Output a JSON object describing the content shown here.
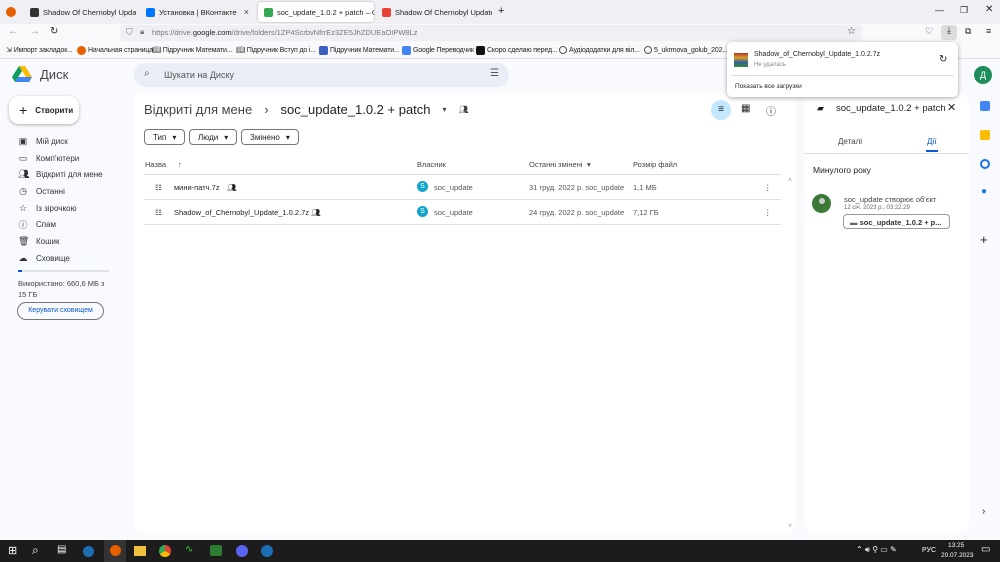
{
  "browser": {
    "tabs": [
      {
        "title": "Shadow Of Chernobyl Update 1",
        "color": "#333"
      },
      {
        "title": "Установка | ВКонтакте",
        "color": "#0077ff"
      },
      {
        "title": "soc_update_1.0.2 + patch – Goo",
        "color": "#34a853",
        "active": true
      },
      {
        "title": "Shadow Of Chernobyl Update 1",
        "color": "#ea4335"
      }
    ],
    "url_prefix": "https://drive.",
    "url_domain": "google.com",
    "url_path": "/drive/folders/1ZP4ScrbvNfrrEz3ZE5JhZDUEaOIPW8Lz",
    "bookmarks": [
      "Импорт закладок...",
      "Начальная страница",
      "Підручник Математи...",
      "Підручник Вступ до і...",
      "Підручник Математи...",
      "Google Переводчик",
      "Скоро сделаю перед...",
      "Аудіододатки для віл...",
      "5_ukrmova_golub_202..."
    ]
  },
  "download": {
    "file": "Shadow_of_Chernobyl_Update_1.0.2.7z",
    "status": "Не удалась",
    "show_all": "Показать все загрузки"
  },
  "drive": {
    "logo": "Диск",
    "search_placeholder": "Шукати на Диску",
    "create": "Створити",
    "avatar": "Д",
    "nav": [
      {
        "label": "Мій диск",
        "icon": "drive-icon"
      },
      {
        "label": "Комп'ютери",
        "icon": "computer-icon"
      },
      {
        "label": "Відкриті для мене",
        "icon": "shared-icon"
      },
      {
        "label": "Останні",
        "icon": "clock-icon"
      },
      {
        "label": "Із зірочкою",
        "icon": "star-icon"
      },
      {
        "label": "Спам",
        "icon": "spam-icon"
      },
      {
        "label": "Кошик",
        "icon": "trash-icon"
      },
      {
        "label": "Сховище",
        "icon": "cloud-icon"
      }
    ],
    "storage_text": "Використано: 660,6 МБ з 15 ГБ",
    "storage_fraction": 0.043,
    "manage_storage": "Керувати сховищем",
    "breadcrumb_parent": "Відкриті для мене",
    "breadcrumb_current": "soc_update_1.0.2 + patch",
    "filters": [
      "Тип",
      "Люди",
      "Змінено"
    ],
    "columns": {
      "name": "Назва",
      "owner": "Власник",
      "modified": "Останні змінені",
      "size": "Розмір файл"
    },
    "files": [
      {
        "name": "мини-патч.7z",
        "owner": "soc_update",
        "owner_initial": "S",
        "modified": "31 груд. 2022 р. soc_update",
        "size": "1,1 МБ"
      },
      {
        "name": "Shadow_of_Chernobyl_Update_1.0.2.7z",
        "owner": "soc_update",
        "owner_initial": "S",
        "modified": "24 груд. 2022 р. soc_update",
        "size": "7,12 ГБ"
      }
    ]
  },
  "panel": {
    "title": "soc_update_1.0.2 + patch",
    "tabs": [
      "Деталі",
      "Дії"
    ],
    "section": "Минулого року",
    "activity": "soc_update створює об'єкт",
    "activity_time": "12 січ. 2023 р., 03:22:29",
    "activity_item": "soc_update_1.0.2 + p..."
  },
  "taskbar": {
    "lang": "РУС",
    "time": "13:25",
    "date": "20.07.2023"
  }
}
